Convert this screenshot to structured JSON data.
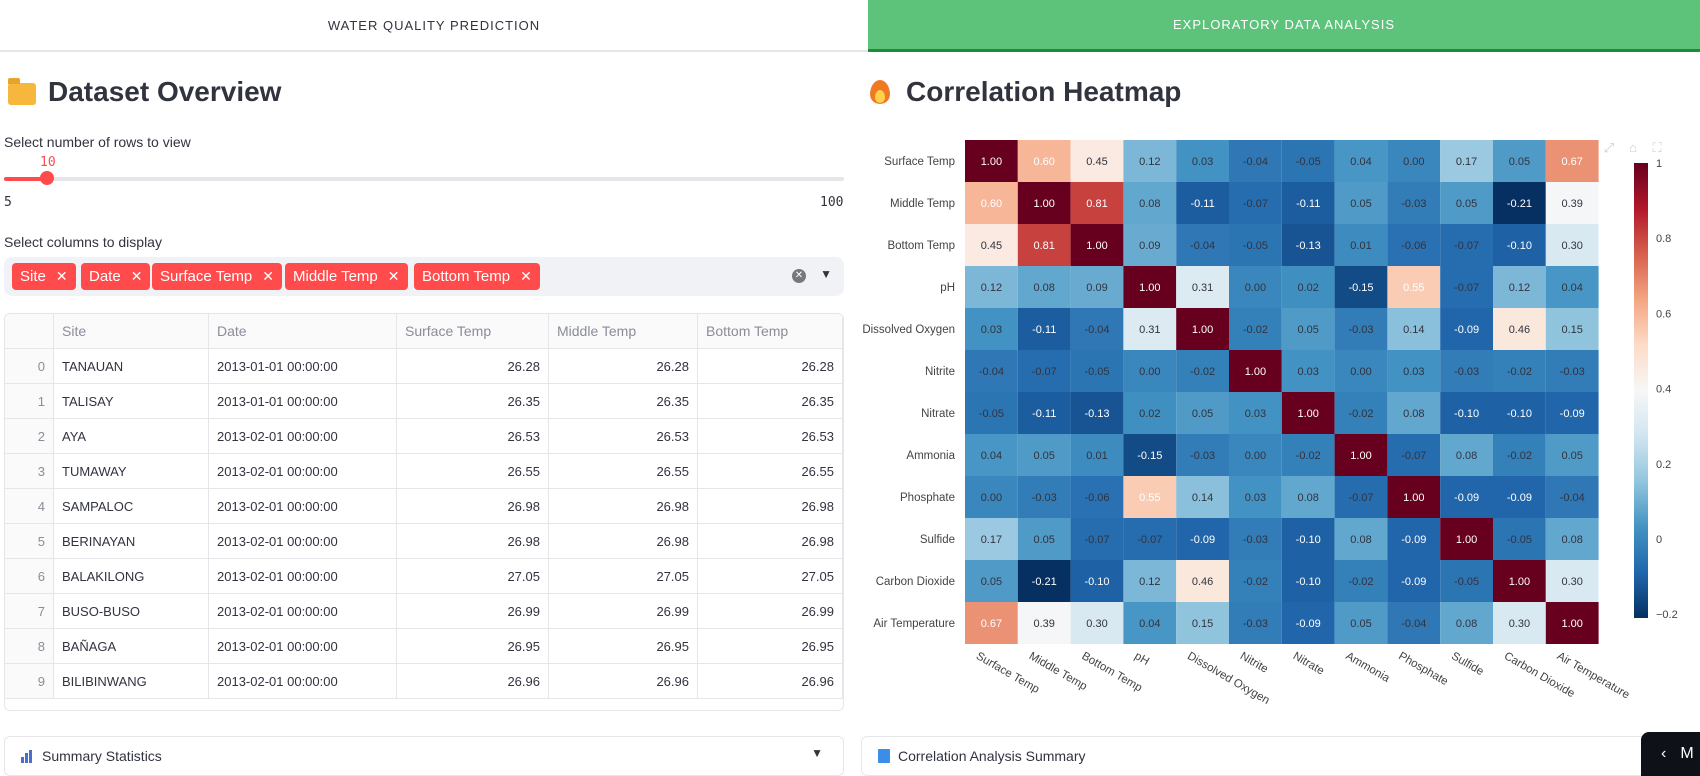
{
  "tabs": [
    {
      "label": "WATER QUALITY PREDICTION",
      "active": false
    },
    {
      "label": "EXPLORATORY DATA ANALYSIS",
      "active": true
    }
  ],
  "overview": {
    "title": "Dataset Overview",
    "rows_label": "Select number of rows to view",
    "rows_value": "10",
    "rows_min": "5",
    "rows_max": "100",
    "columns_label": "Select columns to display",
    "selected_columns": [
      "Site",
      "Date",
      "Surface Temp",
      "Middle Temp",
      "Bottom Temp"
    ]
  },
  "table": {
    "headers": [
      "",
      "Site",
      "Date",
      "Surface Temp",
      "Middle Temp",
      "Bottom Temp"
    ],
    "rows": [
      [
        "0",
        "TANAUAN",
        "2013-01-01 00:00:00",
        "26.28",
        "26.28",
        "26.28"
      ],
      [
        "1",
        "TALISAY",
        "2013-01-01 00:00:00",
        "26.35",
        "26.35",
        "26.35"
      ],
      [
        "2",
        "AYA",
        "2013-02-01 00:00:00",
        "26.53",
        "26.53",
        "26.53"
      ],
      [
        "3",
        "TUMAWAY",
        "2013-02-01 00:00:00",
        "26.55",
        "26.55",
        "26.55"
      ],
      [
        "4",
        "SAMPALOC",
        "2013-02-01 00:00:00",
        "26.98",
        "26.98",
        "26.98"
      ],
      [
        "5",
        "BERINAYAN",
        "2013-02-01 00:00:00",
        "26.98",
        "26.98",
        "26.98"
      ],
      [
        "6",
        "BALAKILONG",
        "2013-02-01 00:00:00",
        "27.05",
        "27.05",
        "27.05"
      ],
      [
        "7",
        "BUSO-BUSO",
        "2013-02-01 00:00:00",
        "26.99",
        "26.99",
        "26.99"
      ],
      [
        "8",
        "BAÑAGA",
        "2013-02-01 00:00:00",
        "26.95",
        "26.95",
        "26.95"
      ],
      [
        "9",
        "BILIBINWANG",
        "2013-02-01 00:00:00",
        "26.96",
        "26.96",
        "26.96"
      ]
    ]
  },
  "summary_statistics_label": "Summary Statistics",
  "heatmap_section": {
    "title": "Correlation Heatmap",
    "analysis_label": "Correlation Analysis Summary"
  },
  "chart_data": {
    "type": "heatmap",
    "title": "",
    "variables": [
      "Surface Temp",
      "Middle Temp",
      "Bottom Temp",
      "pH",
      "Dissolved Oxygen",
      "Nitrite",
      "Nitrate",
      "Ammonia",
      "Phosphate",
      "Sulfide",
      "Carbon Dioxide",
      "Air Temperature"
    ],
    "matrix": [
      [
        1.0,
        0.6,
        0.45,
        0.12,
        0.03,
        -0.04,
        -0.05,
        0.04,
        0.0,
        0.17,
        0.05,
        0.67
      ],
      [
        0.6,
        1.0,
        0.81,
        0.08,
        -0.11,
        -0.07,
        -0.11,
        0.05,
        -0.03,
        0.05,
        -0.21,
        0.39
      ],
      [
        0.45,
        0.81,
        1.0,
        0.09,
        -0.04,
        -0.05,
        -0.13,
        0.01,
        -0.06,
        -0.07,
        -0.1,
        0.3
      ],
      [
        0.12,
        0.08,
        0.09,
        1.0,
        0.31,
        0.0,
        0.02,
        -0.15,
        0.55,
        -0.07,
        0.12,
        0.04
      ],
      [
        0.03,
        -0.11,
        -0.04,
        0.31,
        1.0,
        -0.02,
        0.05,
        -0.03,
        0.14,
        -0.09,
        0.46,
        0.15
      ],
      [
        -0.04,
        -0.07,
        -0.05,
        0.0,
        -0.02,
        1.0,
        0.03,
        0.0,
        0.03,
        -0.03,
        -0.02,
        -0.03
      ],
      [
        -0.05,
        -0.11,
        -0.13,
        0.02,
        0.05,
        0.03,
        1.0,
        -0.02,
        0.08,
        -0.1,
        -0.1,
        -0.09
      ],
      [
        0.04,
        0.05,
        0.01,
        -0.15,
        -0.03,
        0.0,
        -0.02,
        1.0,
        -0.07,
        0.08,
        -0.02,
        0.05
      ],
      [
        0.0,
        -0.03,
        -0.06,
        0.55,
        0.14,
        0.03,
        0.08,
        -0.07,
        1.0,
        -0.09,
        -0.09,
        -0.04
      ],
      [
        0.17,
        0.05,
        -0.07,
        -0.07,
        -0.09,
        -0.03,
        -0.1,
        0.08,
        -0.09,
        1.0,
        -0.05,
        0.08
      ],
      [
        0.05,
        -0.21,
        -0.1,
        0.12,
        0.46,
        -0.02,
        -0.1,
        -0.02,
        -0.09,
        -0.05,
        1.0,
        0.3
      ],
      [
        0.67,
        0.39,
        0.3,
        0.04,
        0.15,
        -0.03,
        -0.09,
        0.05,
        -0.04,
        0.08,
        0.3,
        1.0
      ]
    ],
    "colorscale": "RdBu reversed",
    "zrange": [
      -0.21,
      1.0
    ],
    "colorbar_ticks": [
      "1",
      "0.8",
      "0.6",
      "0.4",
      "0.2",
      "0",
      "−0.2"
    ]
  },
  "icons": {
    "folder": "folder-icon",
    "fire": "fire-icon",
    "bar_chart": "bar-chart-icon",
    "book": "book-icon"
  },
  "colors": {
    "accent": "#ff4b4b",
    "active_tab": "#5dc37b"
  },
  "sidebar_toggle_label": "M"
}
